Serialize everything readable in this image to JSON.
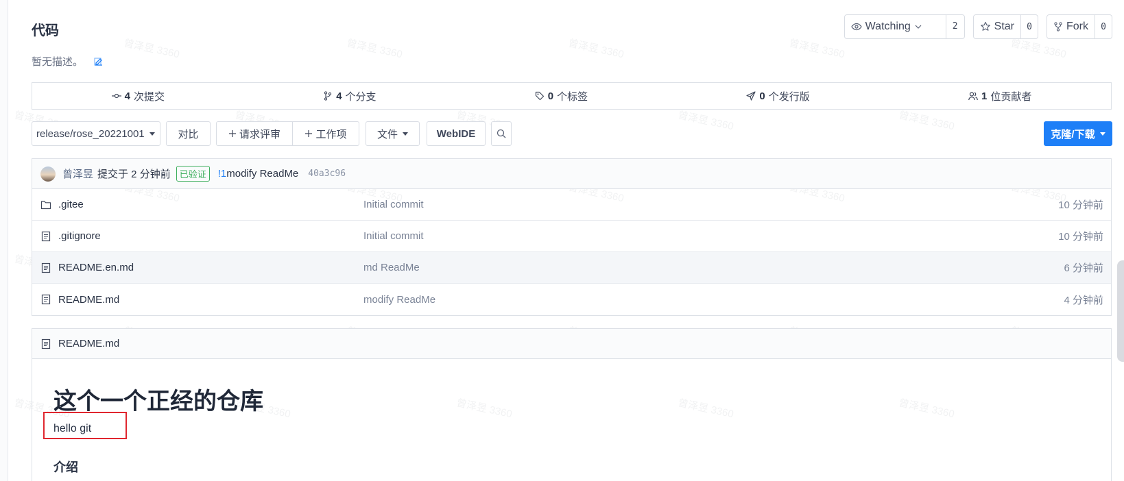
{
  "header": {
    "title": "代码",
    "description": "暂无描述。"
  },
  "actions": {
    "watch_label": "Watching",
    "watch_count": "2",
    "star_label": "Star",
    "star_count": "0",
    "fork_label": "Fork",
    "fork_count": "0"
  },
  "stats": [
    {
      "num": "4",
      "label": "次提交",
      "icon": "commit-icon"
    },
    {
      "num": "4",
      "label": "个分支",
      "icon": "branch-icon"
    },
    {
      "num": "0",
      "label": "个标签",
      "icon": "tag-icon"
    },
    {
      "num": "0",
      "label": "个发行版",
      "icon": "release-icon"
    },
    {
      "num": "1",
      "label": "位贡献者",
      "icon": "contributors-icon"
    }
  ],
  "toolbar": {
    "branch": "release/rose_20221001",
    "compare": "对比",
    "pull_request": "请求评审",
    "work_item": "工作项",
    "file": "文件",
    "webide": "WebIDE",
    "clone": "克隆/下载"
  },
  "commit": {
    "author": "曾泽昱",
    "action": "提交于 2 分钟前",
    "verified": "已验证",
    "pr_ref": "!1",
    "message": "modify ReadMe",
    "sha": "40a3c96"
  },
  "files": [
    {
      "name": ".gitee",
      "type": "folder",
      "message": "Initial commit",
      "time": "10 分钟前"
    },
    {
      "name": ".gitignore",
      "type": "file",
      "message": "Initial commit",
      "time": "10 分钟前"
    },
    {
      "name": "README.en.md",
      "type": "file",
      "message": "md ReadMe",
      "time": "6 分钟前"
    },
    {
      "name": "README.md",
      "type": "file",
      "message": "modify ReadMe",
      "time": "4 分钟前"
    }
  ],
  "readme": {
    "filename": "README.md",
    "heading": "这个一个正经的仓库",
    "paragraph": "hello git",
    "subheading": "介绍"
  },
  "watermark_text": "曾泽昱 3360",
  "colors": {
    "accent": "#1e7ff7",
    "verified": "#3eaf5e",
    "highlight_box": "#e0262e"
  }
}
